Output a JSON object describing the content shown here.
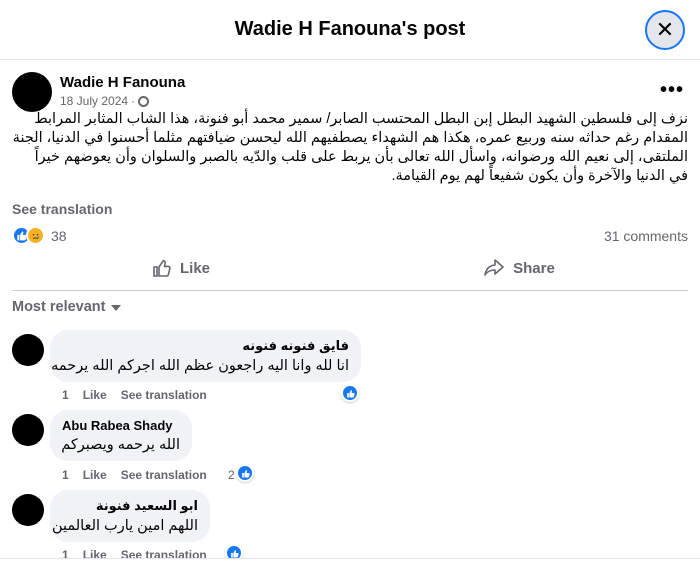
{
  "header": {
    "title": "Wadie H Fanouna's post",
    "close_icon": "✕"
  },
  "post": {
    "author": "Wadie H Fanouna",
    "date": "18 July 2024",
    "more_icon": "•••",
    "text": "نزف إلى فلسطين الشهيد البطل إبن البطل المحتسب الصابر/ سمير محمد أبو فنونة، هذا الشاب المثابر المرابط المقدام رغم حداثه سنه وربيع عمره، هكذا هم الشهداء يصطفيهم الله ليحسن ضيافتهم مثلما أحسنوا في الدنيا، الجنة الملتقى، إلى نعيم الله ورضوانه، واسأل الله تعالى بأن يربط على قلب والدّيه بالصبر والسلوان وأن يعوضهم خيراً في الدنيا والآخرة وأن يكون شفيعاً لهم يوم القيامة.",
    "see_translation": "See translation",
    "reaction_count": "38",
    "comments_count": "31 comments",
    "like_label": "Like",
    "share_label": "Share"
  },
  "comments_filter": "Most relevant",
  "comments": [
    {
      "name": "فايق فنونه فنونه",
      "text": "انا لله وانا اليه راجعون عظم الله اجركم الله يرحمه",
      "time": "1",
      "like": "Like",
      "translate": "See translation",
      "reactions": ""
    },
    {
      "name": "Abu Rabea Shady",
      "text": "الله يرحمه ويصبركم",
      "time": "1",
      "like": "Like",
      "translate": "See translation",
      "reactions": "2"
    },
    {
      "name": "ابو السعيد فنونة",
      "text": "اللهم امين يارب العالمين",
      "time": "1",
      "like": "Like",
      "translate": "See translation",
      "reactions": ""
    }
  ],
  "colors": {
    "accent": "#1877f2",
    "muted": "#65676b",
    "bubble": "#f0f2f5"
  },
  "icons": {
    "like": "like-icon",
    "share": "share-icon",
    "globe": "globe-icon",
    "sad": "sad-reaction-icon"
  }
}
